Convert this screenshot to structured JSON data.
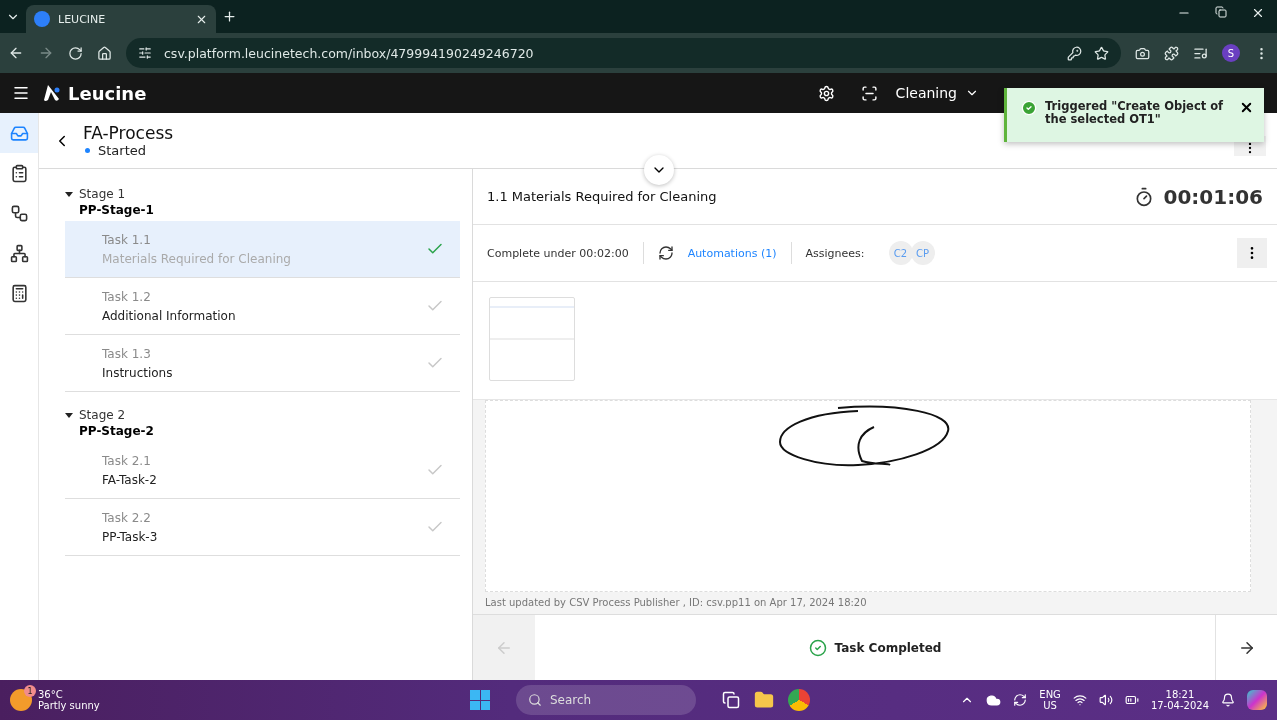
{
  "browser": {
    "tab_title": "LEUCINE",
    "url": "csv.platform.leucinetech.com/inbox/479994190249246720",
    "profile_initial": "S"
  },
  "app": {
    "brand": "Leucine",
    "facility": "Cleaning"
  },
  "toast": {
    "message": "Triggered \"Create Object of the selected OT1\""
  },
  "nav": [
    {
      "kind": "inbox",
      "selected": true
    },
    {
      "kind": "checklist",
      "selected": false
    },
    {
      "kind": "flow",
      "selected": false
    },
    {
      "kind": "hierarchy",
      "selected": false
    },
    {
      "kind": "report",
      "selected": false
    }
  ],
  "process": {
    "title": "FA-Process",
    "status": "Started"
  },
  "stages": [
    {
      "label": "Stage 1",
      "name": "PP-Stage-1",
      "expanded": true,
      "tasks": [
        {
          "label": "Task 1.1",
          "name": "Materials Required for Cleaning",
          "selected": true,
          "completed": true
        },
        {
          "label": "Task 1.2",
          "name": "Additional Information",
          "selected": false,
          "completed": false
        },
        {
          "label": "Task 1.3",
          "name": "Instructions",
          "selected": false,
          "completed": false
        }
      ]
    },
    {
      "label": "Stage 2",
      "name": "PP-Stage-2",
      "expanded": true,
      "tasks": [
        {
          "label": "Task 2.1",
          "name": "FA-Task-2",
          "selected": false,
          "completed": false
        },
        {
          "label": "Task 2.2",
          "name": "PP-Task-3",
          "selected": false,
          "completed": false
        }
      ]
    }
  ],
  "task": {
    "title": "1.1 Materials Required for Cleaning",
    "timer": "00:01:06",
    "complete_under": "Complete under 00:02:00",
    "automations": "Automations (1)",
    "assignees_label": "Assignees:",
    "assignees": [
      "C2",
      "CP"
    ],
    "last_updated": "Last updated by CSV Process Publisher , ID: csv.pp11 on Apr 17, 2024 18:20",
    "status": "Task Completed"
  },
  "taskbar": {
    "temperature": "36°C",
    "weather": "Partly sunny",
    "weather_badge": "1",
    "search_placeholder": "Search",
    "language": "ENG",
    "region": "US",
    "time": "18:21",
    "date": "17-04-2024"
  }
}
